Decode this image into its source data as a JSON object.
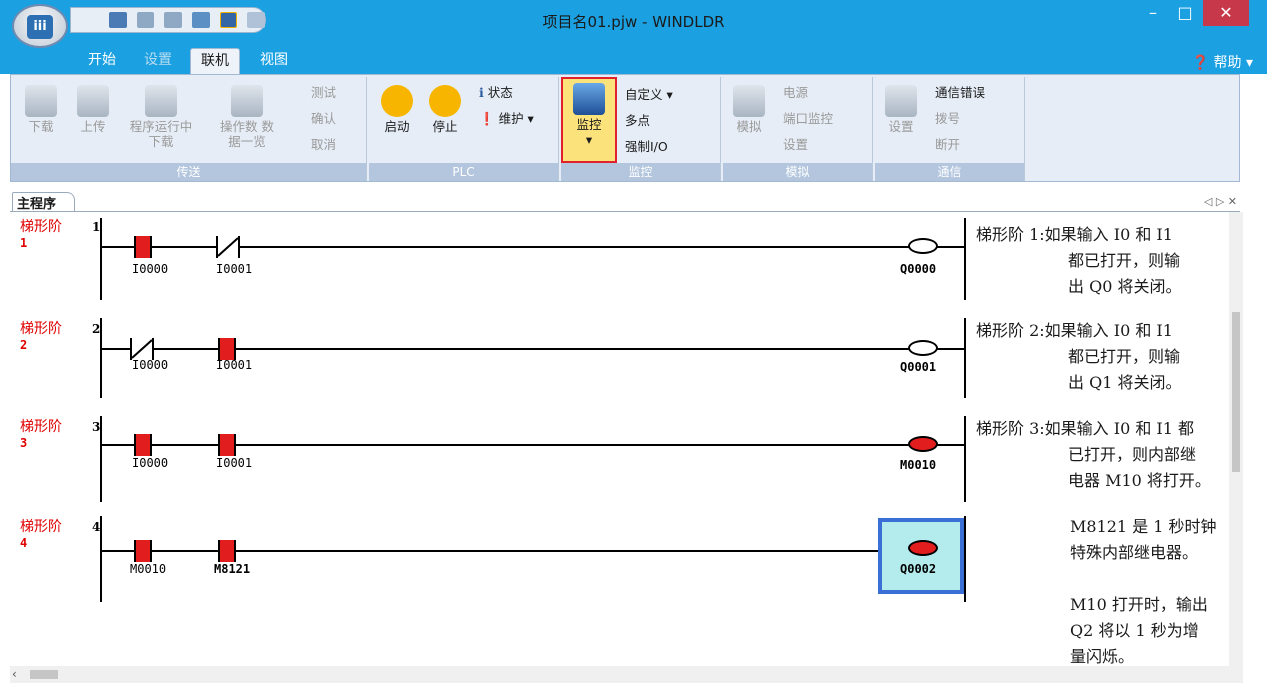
{
  "window": {
    "title": "项目名01.pjw - WINDLDR",
    "minimize": "–",
    "maximize": "□",
    "close": "✕"
  },
  "app_icon": "iii",
  "tabs": [
    "开始",
    "设置",
    "联机",
    "视图"
  ],
  "help": "❓ 帮助 ▾",
  "ribbon": {
    "transfer": {
      "label": "传送",
      "download": "下载",
      "upload": "上传",
      "run_download": "程序运行中下载",
      "operand_list": "操作数 数据一览",
      "test": "测试",
      "confirm": "确认",
      "cancel": "取消"
    },
    "plc": {
      "label": "PLC",
      "start": "启动",
      "stop": "停止",
      "status": "状态",
      "maintenance": "维护"
    },
    "monitor": {
      "label": "监控",
      "monitor": "监控",
      "custom": "自定义",
      "multipoint": "多点",
      "force_io": "强制I/O"
    },
    "simulate": {
      "label": "模拟",
      "simulate": "模拟",
      "power": "电源",
      "port_monitor": "端口监控",
      "settings": "设置"
    },
    "comm": {
      "label": "通信",
      "settings": "设置",
      "comm_error": "通信错误",
      "dial": "拨号",
      "disconnect": "断开"
    }
  },
  "doc_tab": "主程序",
  "doc_controls": "◁ ▷ ✕",
  "rungs": [
    {
      "label": "梯形阶",
      "num": "1",
      "index": "1",
      "c1": "I0000",
      "c2": "I0001",
      "coil": "Q0000",
      "comment_head": "梯形阶 1:",
      "comment": [
        "如果输入 I0 和 I1",
        "都已打开，则输",
        "出 Q0 将关闭。"
      ]
    },
    {
      "label": "梯形阶",
      "num": "2",
      "index": "2",
      "c1": "I0000",
      "c2": "I0001",
      "coil": "Q0001",
      "comment_head": "梯形阶 2:",
      "comment": [
        "如果输入 I0 和 I1",
        "都已打开，则输",
        "出 Q1 将关闭。"
      ]
    },
    {
      "label": "梯形阶",
      "num": "3",
      "index": "3",
      "c1": "I0000",
      "c2": "I0001",
      "coil": "M0010",
      "comment_head": "梯形阶 3:",
      "comment": [
        "如果输入 I0 和 I1 都",
        "已打开，则内部继",
        "电器 M10 将打开。"
      ]
    },
    {
      "label": "梯形阶",
      "num": "4",
      "index": "4",
      "c1": "M0010",
      "c2": "M8121",
      "coil": "Q0002",
      "comment_head": "",
      "comment": [
        "M8121 是 1 秒时钟",
        "特殊内部继电器。",
        "M10 打开时，输出",
        "Q2 将以 1 秒为增",
        "量闪烁。"
      ]
    }
  ]
}
